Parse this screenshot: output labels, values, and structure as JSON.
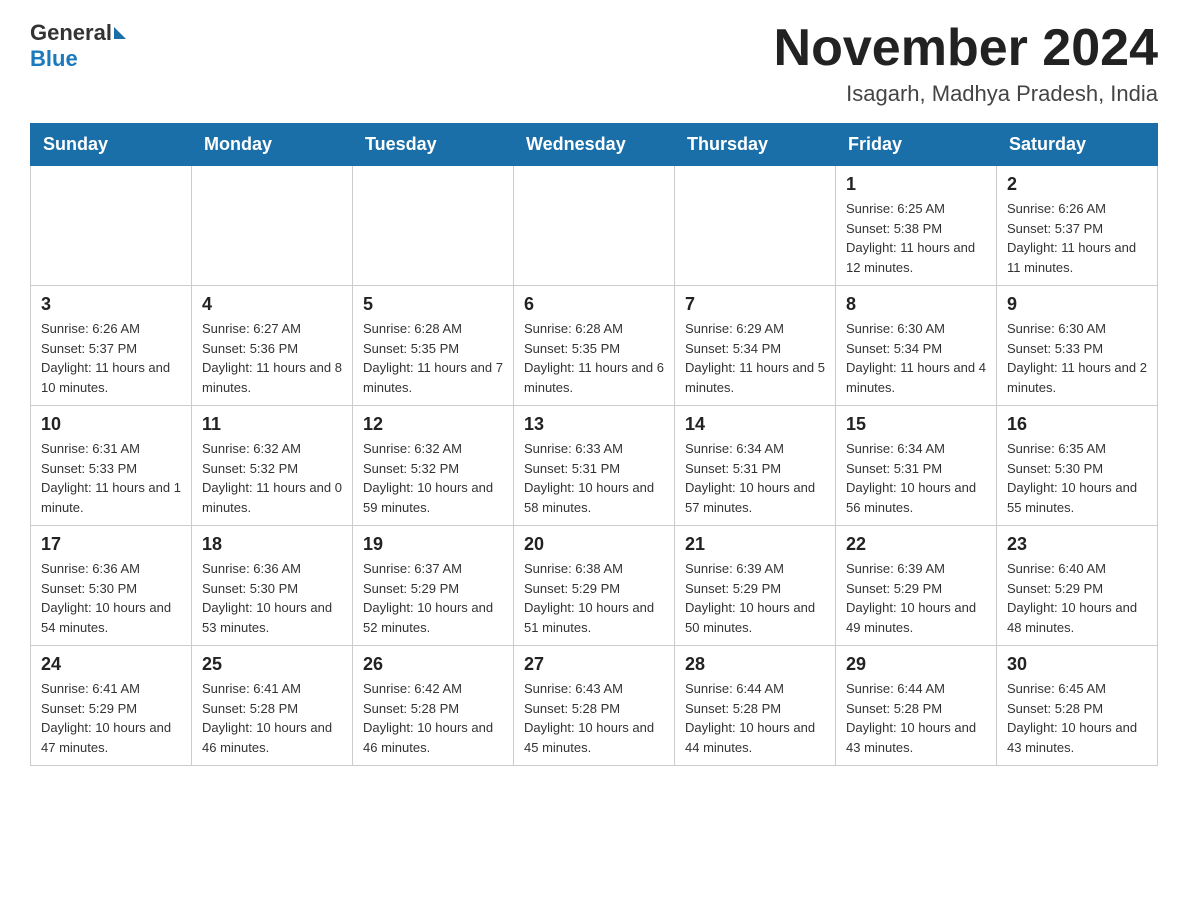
{
  "header": {
    "logo_text_general": "General",
    "logo_text_blue": "Blue",
    "month_year": "November 2024",
    "location": "Isagarh, Madhya Pradesh, India"
  },
  "days_of_week": [
    "Sunday",
    "Monday",
    "Tuesday",
    "Wednesday",
    "Thursday",
    "Friday",
    "Saturday"
  ],
  "weeks": [
    [
      {
        "day": "",
        "info": ""
      },
      {
        "day": "",
        "info": ""
      },
      {
        "day": "",
        "info": ""
      },
      {
        "day": "",
        "info": ""
      },
      {
        "day": "",
        "info": ""
      },
      {
        "day": "1",
        "info": "Sunrise: 6:25 AM\nSunset: 5:38 PM\nDaylight: 11 hours and 12 minutes."
      },
      {
        "day": "2",
        "info": "Sunrise: 6:26 AM\nSunset: 5:37 PM\nDaylight: 11 hours and 11 minutes."
      }
    ],
    [
      {
        "day": "3",
        "info": "Sunrise: 6:26 AM\nSunset: 5:37 PM\nDaylight: 11 hours and 10 minutes."
      },
      {
        "day": "4",
        "info": "Sunrise: 6:27 AM\nSunset: 5:36 PM\nDaylight: 11 hours and 8 minutes."
      },
      {
        "day": "5",
        "info": "Sunrise: 6:28 AM\nSunset: 5:35 PM\nDaylight: 11 hours and 7 minutes."
      },
      {
        "day": "6",
        "info": "Sunrise: 6:28 AM\nSunset: 5:35 PM\nDaylight: 11 hours and 6 minutes."
      },
      {
        "day": "7",
        "info": "Sunrise: 6:29 AM\nSunset: 5:34 PM\nDaylight: 11 hours and 5 minutes."
      },
      {
        "day": "8",
        "info": "Sunrise: 6:30 AM\nSunset: 5:34 PM\nDaylight: 11 hours and 4 minutes."
      },
      {
        "day": "9",
        "info": "Sunrise: 6:30 AM\nSunset: 5:33 PM\nDaylight: 11 hours and 2 minutes."
      }
    ],
    [
      {
        "day": "10",
        "info": "Sunrise: 6:31 AM\nSunset: 5:33 PM\nDaylight: 11 hours and 1 minute."
      },
      {
        "day": "11",
        "info": "Sunrise: 6:32 AM\nSunset: 5:32 PM\nDaylight: 11 hours and 0 minutes."
      },
      {
        "day": "12",
        "info": "Sunrise: 6:32 AM\nSunset: 5:32 PM\nDaylight: 10 hours and 59 minutes."
      },
      {
        "day": "13",
        "info": "Sunrise: 6:33 AM\nSunset: 5:31 PM\nDaylight: 10 hours and 58 minutes."
      },
      {
        "day": "14",
        "info": "Sunrise: 6:34 AM\nSunset: 5:31 PM\nDaylight: 10 hours and 57 minutes."
      },
      {
        "day": "15",
        "info": "Sunrise: 6:34 AM\nSunset: 5:31 PM\nDaylight: 10 hours and 56 minutes."
      },
      {
        "day": "16",
        "info": "Sunrise: 6:35 AM\nSunset: 5:30 PM\nDaylight: 10 hours and 55 minutes."
      }
    ],
    [
      {
        "day": "17",
        "info": "Sunrise: 6:36 AM\nSunset: 5:30 PM\nDaylight: 10 hours and 54 minutes."
      },
      {
        "day": "18",
        "info": "Sunrise: 6:36 AM\nSunset: 5:30 PM\nDaylight: 10 hours and 53 minutes."
      },
      {
        "day": "19",
        "info": "Sunrise: 6:37 AM\nSunset: 5:29 PM\nDaylight: 10 hours and 52 minutes."
      },
      {
        "day": "20",
        "info": "Sunrise: 6:38 AM\nSunset: 5:29 PM\nDaylight: 10 hours and 51 minutes."
      },
      {
        "day": "21",
        "info": "Sunrise: 6:39 AM\nSunset: 5:29 PM\nDaylight: 10 hours and 50 minutes."
      },
      {
        "day": "22",
        "info": "Sunrise: 6:39 AM\nSunset: 5:29 PM\nDaylight: 10 hours and 49 minutes."
      },
      {
        "day": "23",
        "info": "Sunrise: 6:40 AM\nSunset: 5:29 PM\nDaylight: 10 hours and 48 minutes."
      }
    ],
    [
      {
        "day": "24",
        "info": "Sunrise: 6:41 AM\nSunset: 5:29 PM\nDaylight: 10 hours and 47 minutes."
      },
      {
        "day": "25",
        "info": "Sunrise: 6:41 AM\nSunset: 5:28 PM\nDaylight: 10 hours and 46 minutes."
      },
      {
        "day": "26",
        "info": "Sunrise: 6:42 AM\nSunset: 5:28 PM\nDaylight: 10 hours and 46 minutes."
      },
      {
        "day": "27",
        "info": "Sunrise: 6:43 AM\nSunset: 5:28 PM\nDaylight: 10 hours and 45 minutes."
      },
      {
        "day": "28",
        "info": "Sunrise: 6:44 AM\nSunset: 5:28 PM\nDaylight: 10 hours and 44 minutes."
      },
      {
        "day": "29",
        "info": "Sunrise: 6:44 AM\nSunset: 5:28 PM\nDaylight: 10 hours and 43 minutes."
      },
      {
        "day": "30",
        "info": "Sunrise: 6:45 AM\nSunset: 5:28 PM\nDaylight: 10 hours and 43 minutes."
      }
    ]
  ]
}
